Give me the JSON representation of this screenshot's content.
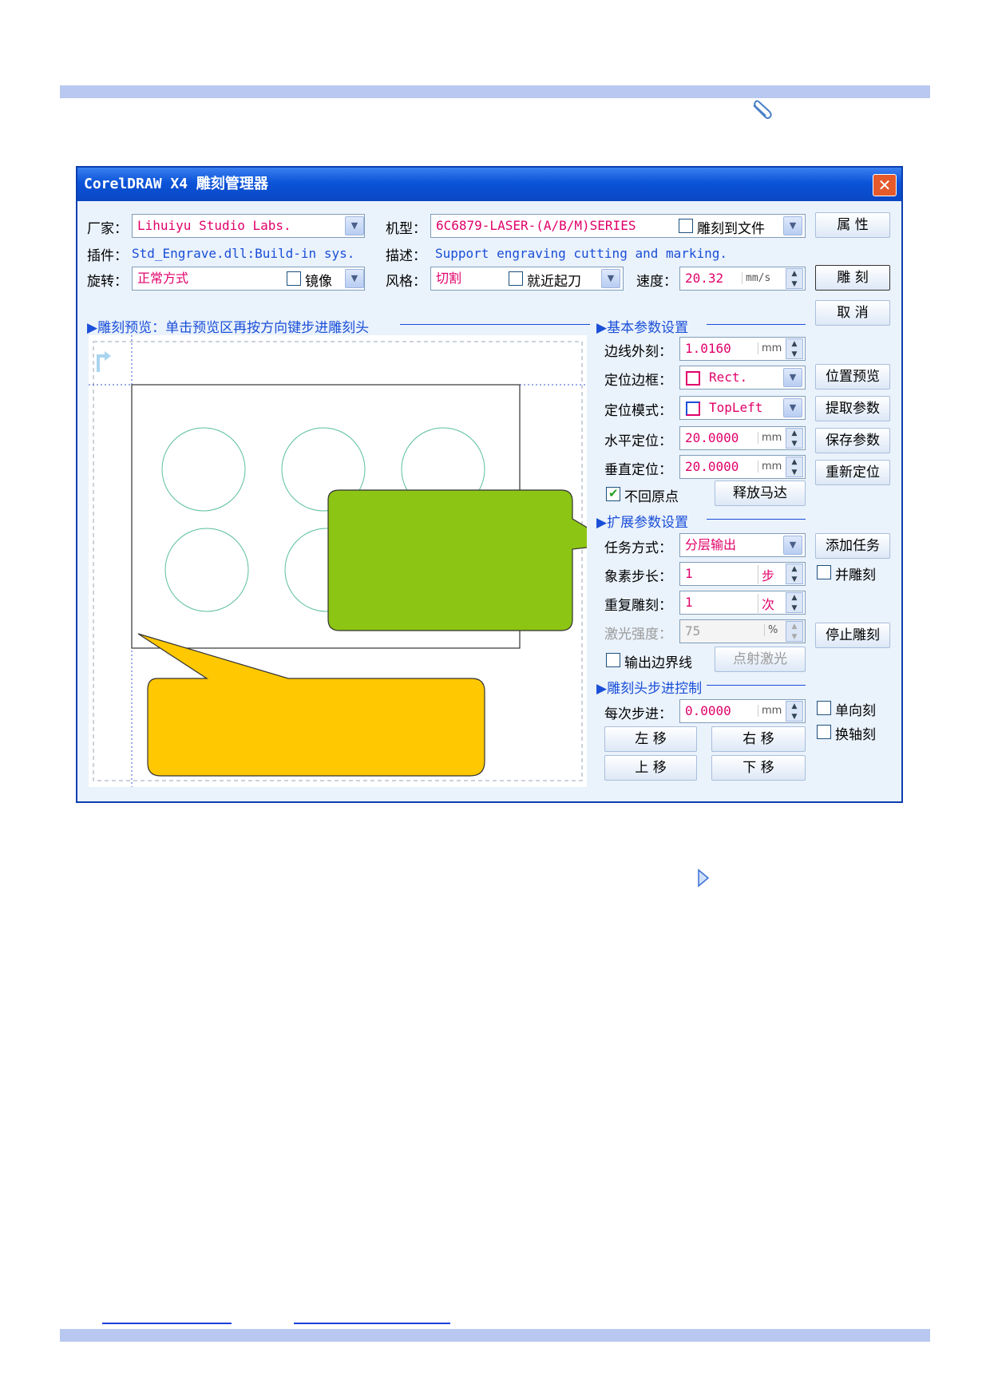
{
  "dialog": {
    "title": "CorelDRAW X4 雕刻管理器",
    "close_glyph": "✕"
  },
  "top": {
    "vendor_label": "厂家：",
    "vendor_value": "Lihuiyu Studio Labs.",
    "model_label": "机型：",
    "model_value": "6C6879-LASER-(A/B/M)SERIES",
    "engrave_to_file": "雕刻到文件",
    "plugin_label": "插件：",
    "plugin_value": "Std_Engrave.dll:Build-in sys.",
    "desc_label": "描述：",
    "desc_value": "Support engraving cutting and marking.",
    "rotate_label": "旋转：",
    "rotate_value": "正常方式",
    "mirror": "镜像",
    "style_label": "风格：",
    "style_value": "切割",
    "near_start": "就近起刀",
    "speed_label": "速度：",
    "speed_value": "20.32",
    "speed_unit": "mm/s"
  },
  "side_buttons": {
    "properties": "属  性",
    "engrave": "雕  刻",
    "cancel": "取  消",
    "preview_pos": "位置预览",
    "get_params": "提取参数",
    "save_params": "保存参数",
    "reposition": "重新定位",
    "add_task": "添加任务",
    "parallel": "并雕刻",
    "stop": "停止雕刻",
    "one_way": "单向刻",
    "swap_axis": "换轴刻"
  },
  "preview": {
    "header": "雕刻预览：单击预览区再按方向键步进雕刻头"
  },
  "basic": {
    "header": "基本参数设置",
    "margin_label": "边线外刻：",
    "margin_value": "1.0160",
    "margin_unit": "mm",
    "frame_label": "定位边框：",
    "frame_value": "Rect.",
    "mode_label": "定位模式：",
    "mode_value": "TopLeft",
    "hpos_label": "水平定位：",
    "hpos_value": "20.0000",
    "hpos_unit": "mm",
    "vpos_label": "垂直定位：",
    "vpos_value": "20.0000",
    "vpos_unit": "mm",
    "no_home": "不回原点",
    "release_motor": "释放马达"
  },
  "ext": {
    "header": "扩展参数设置",
    "task_label": "任务方式：",
    "task_value": "分层输出",
    "pixel_label": "象素步长：",
    "pixel_value": "1",
    "pixel_unit": "步",
    "repeat_label": "重复雕刻：",
    "repeat_value": "1",
    "repeat_unit": "次",
    "laser_label": "激光强度：",
    "laser_value": "75",
    "laser_unit": "%",
    "border_line": "输出边界线",
    "fire_laser": "点射激光"
  },
  "step": {
    "header": "雕刻头步进控制",
    "each_label": "每次步进：",
    "each_value": "0.0000",
    "each_unit": "mm",
    "left": "左  移",
    "right": "右  移",
    "up": "上  移",
    "down": "下  移"
  },
  "colors": {
    "green_callout": "#8cc514",
    "yellow_callout": "#ffc800",
    "circle": "#5bbf9a",
    "accent": "#1a4fd8",
    "value": "#e0006a"
  },
  "icons": [
    "paperclip-icon",
    "triangle-arrow-icon",
    "close-icon",
    "chevron-down-icon"
  ]
}
